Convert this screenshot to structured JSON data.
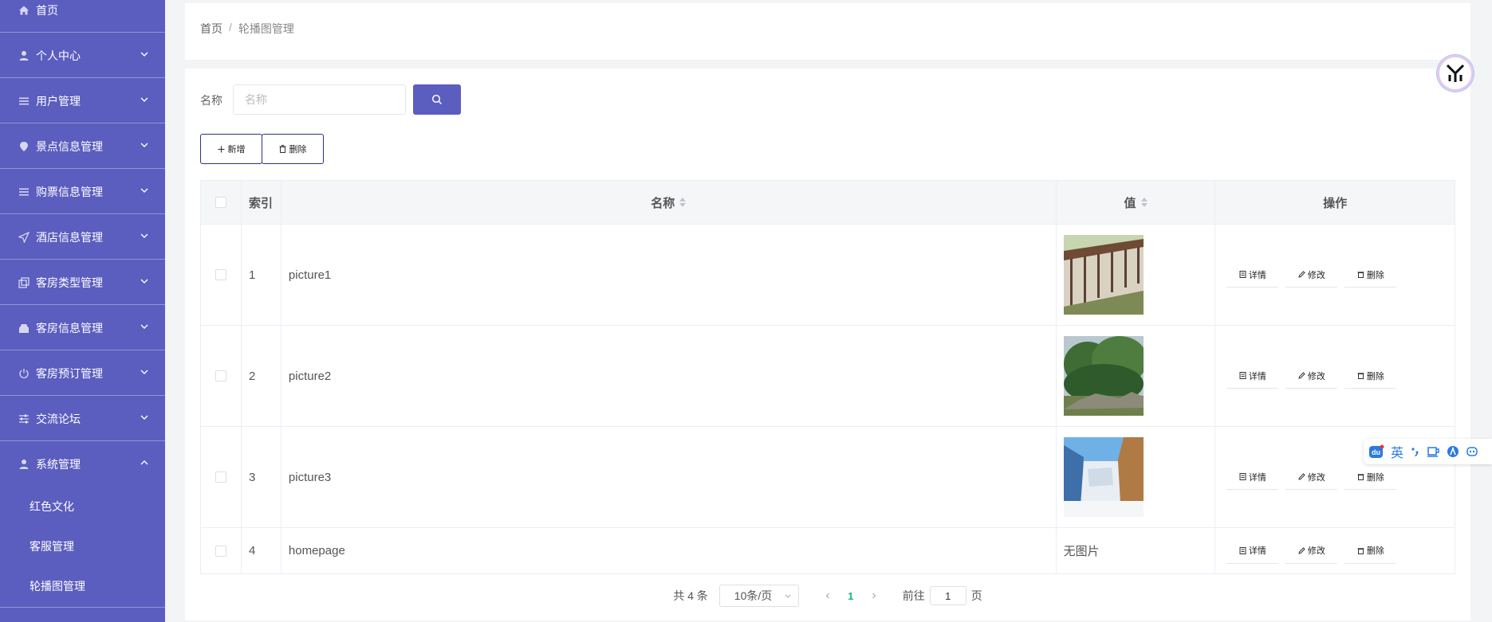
{
  "sidebar": {
    "items": [
      {
        "label": "首页",
        "icon": "home-icon"
      },
      {
        "label": "个人中心",
        "icon": "user-icon"
      },
      {
        "label": "用户管理",
        "icon": "list-icon"
      },
      {
        "label": "景点信息管理",
        "icon": "location-icon"
      },
      {
        "label": "购票信息管理",
        "icon": "list-icon"
      },
      {
        "label": "酒店信息管理",
        "icon": "send-icon"
      },
      {
        "label": "客房类型管理",
        "icon": "copy-icon"
      },
      {
        "label": "客房信息管理",
        "icon": "shop-icon"
      },
      {
        "label": "客房预订管理",
        "icon": "power-icon"
      },
      {
        "label": "交流论坛",
        "icon": "sliders-icon"
      },
      {
        "label": "系统管理",
        "icon": "user-icon"
      }
    ],
    "submenu": [
      "红色文化",
      "客服管理",
      "轮播图管理"
    ]
  },
  "breadcrumb": {
    "home": "首页",
    "separator": "/",
    "current": "轮播图管理"
  },
  "search": {
    "label": "名称",
    "placeholder": "名称",
    "value": ""
  },
  "toolbar": {
    "add_label": "新增",
    "delete_label": "删除"
  },
  "table": {
    "headers": {
      "index": "索引",
      "name": "名称",
      "value": "值",
      "actions": "操作"
    },
    "rows": [
      {
        "index": "1",
        "name": "picture1",
        "image": "corridor",
        "value_text": ""
      },
      {
        "index": "2",
        "name": "picture2",
        "image": "garden",
        "value_text": ""
      },
      {
        "index": "3",
        "name": "picture3",
        "image": "waterfall",
        "value_text": ""
      },
      {
        "index": "4",
        "name": "homepage",
        "image": "",
        "value_text": "无图片"
      }
    ],
    "actions": {
      "detail": "详情",
      "edit": "修改",
      "delete": "删除"
    }
  },
  "pagination": {
    "total": "共 4 条",
    "page_size": "10条/页",
    "current_page": "1",
    "goto_prefix": "前往",
    "goto_value": "1",
    "goto_suffix": "页"
  },
  "ime": {
    "lang": "英"
  },
  "colors": {
    "sidebar": "#5b5dbf",
    "accent": "#5b5dbf",
    "active_page": "#17b978"
  }
}
